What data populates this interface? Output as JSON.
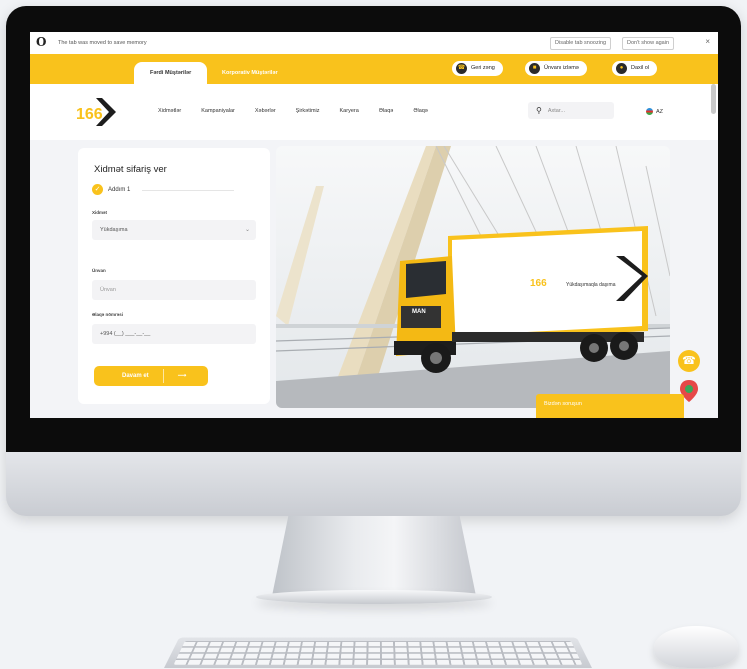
{
  "browser": {
    "notification": "The tab was moved to save memory",
    "buttons": [
      "Disable tab snoozing",
      "Don't show again"
    ],
    "close_label": "×"
  },
  "header": {
    "tabs": [
      "Fərdi Müştərilər",
      "Korporativ Müştərilər"
    ],
    "call_label": "Geri zəng",
    "track_label": "Ünvanı izləmə",
    "login_label": "Daxil ol"
  },
  "nav": {
    "logo_text": "166",
    "menu": [
      "Xidmətlər",
      "Kampaniyalar",
      "Xəbərlər",
      "Şirkətimiz",
      "Karyera",
      "Əlaqə",
      "Əlaqə"
    ],
    "search_placeholder": "Axtar...",
    "language": "AZ"
  },
  "form": {
    "title": "Xidmət sifariş ver",
    "step_label": "Addım 1",
    "service_label": "Xidmət",
    "service_value": "Yükdaşıma",
    "address_label": "Ünvan",
    "address_placeholder": "Ünvan",
    "phone_label": "Əlaqə nömrəsi",
    "phone_placeholder": "+994 (__) ___-__-__",
    "submit_label": "Davam et"
  },
  "hero": {
    "truck_brand": "MAN",
    "truck_logo": "166",
    "truck_text": "Yükdaşımaqla daşıma"
  },
  "chat": {
    "label": "Bizdən soruşun"
  },
  "colors": {
    "brand_yellow": "#f9c21c",
    "dark": "#222222"
  },
  "icons": [
    "phone-icon",
    "box-icon",
    "user-icon",
    "search-icon",
    "check-icon",
    "arrow-right-icon",
    "map-pin-icon"
  ]
}
